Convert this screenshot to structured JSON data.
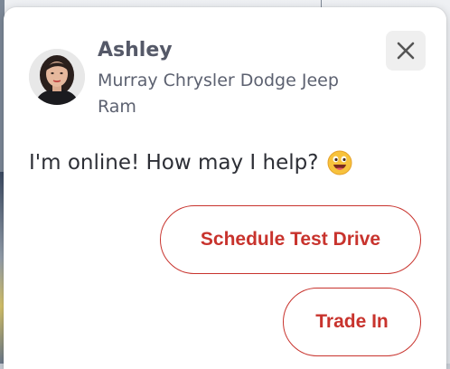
{
  "chat_widget": {
    "agent": {
      "name": "Ashley",
      "dealership": "Murray Chrysler Dodge Jeep Ram",
      "avatar_icon": "agent-portrait-icon"
    },
    "close_button": {
      "icon": "close-icon",
      "color": "#555555"
    },
    "message": {
      "text": "I'm online! How may I help?",
      "emoji_icon": "grinning-face-emoji-icon"
    },
    "quick_replies": [
      {
        "label": "Schedule Test Drive"
      },
      {
        "label": "Trade In"
      }
    ],
    "accent_color": "#c8332d"
  }
}
